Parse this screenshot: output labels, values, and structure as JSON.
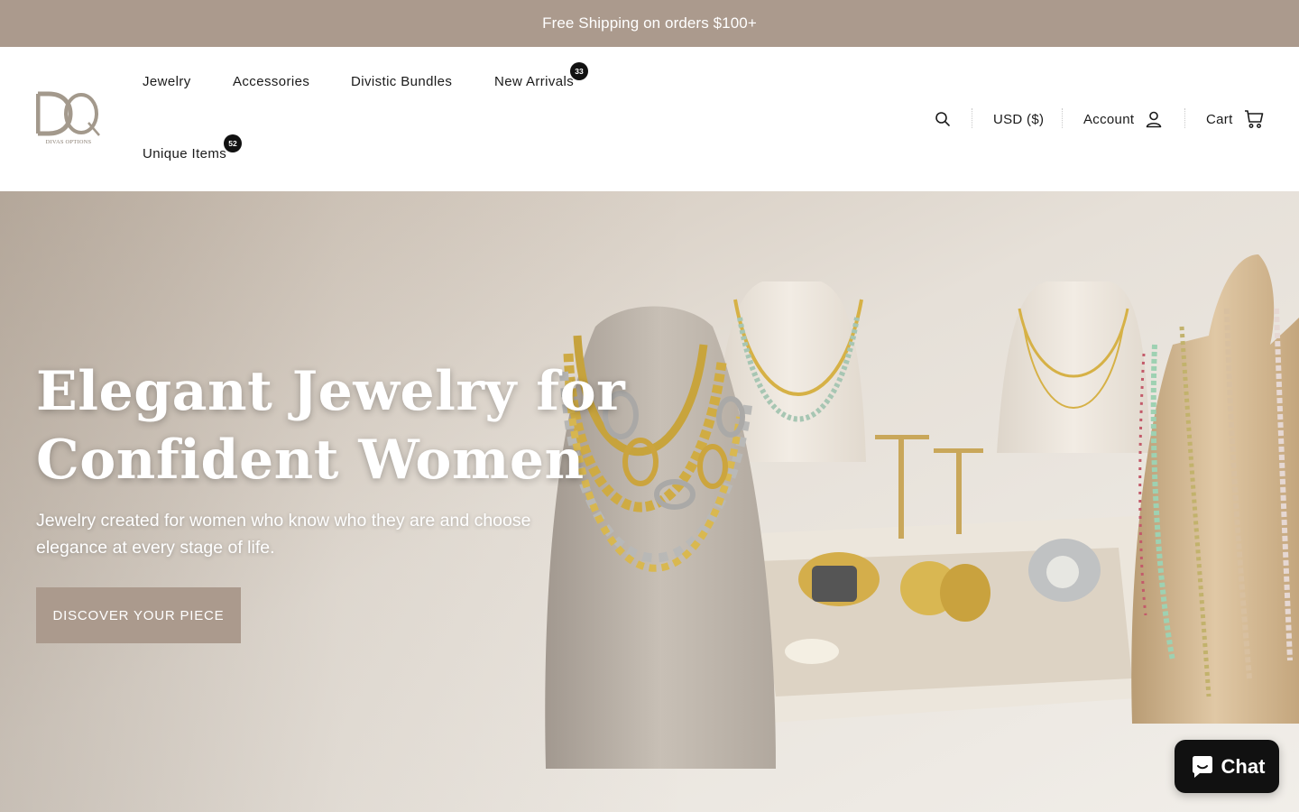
{
  "announcement": {
    "text": "Free Shipping on orders $100+"
  },
  "brand": {
    "logo_text": "DIVAS OPTIONS",
    "color": "#ab9a8d"
  },
  "nav": [
    {
      "label": "Jewelry"
    },
    {
      "label": "Accessories"
    },
    {
      "label": "Divistic Bundles"
    },
    {
      "label": "New Arrivals",
      "badge": "33"
    },
    {
      "label": "Unique Items",
      "badge": "52"
    }
  ],
  "utility": {
    "search_icon": "search-icon",
    "currency": "USD ($)",
    "account": "Account",
    "account_icon": "user-icon",
    "cart": "Cart",
    "cart_icon": "cart-icon"
  },
  "hero": {
    "title_line1": "Elegant Jewelry for",
    "title_line2": "Confident Women",
    "subtitle": "Jewelry created for women who know who they are and choose elegance at every stage of life.",
    "button": "DISCOVER YOUR PIECE"
  },
  "chat": {
    "label": "Chat",
    "icon": "chat-bubble-icon"
  },
  "colors": {
    "accent": "#ab9a8d",
    "announcement_text": "#ffffff",
    "badge": "#111111"
  }
}
